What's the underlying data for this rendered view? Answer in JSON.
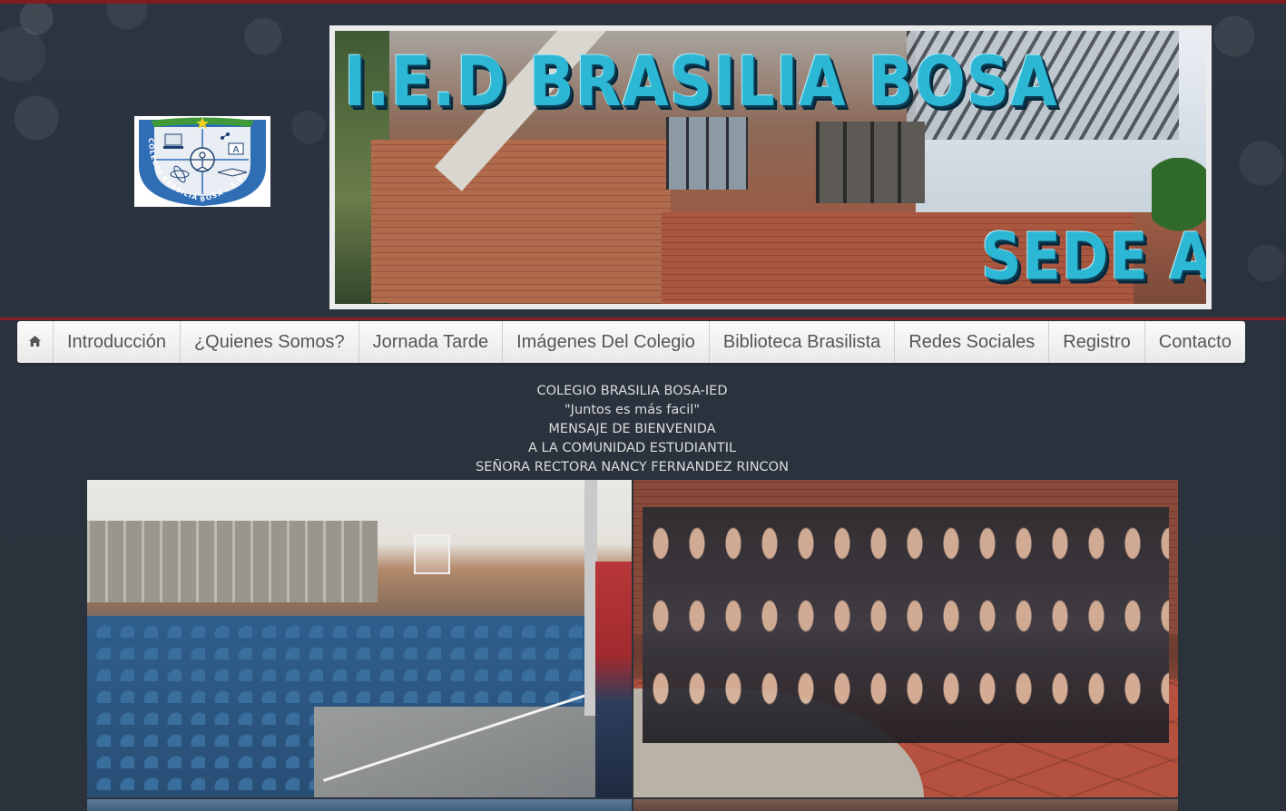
{
  "banner": {
    "title": "I.E.D BRASILIA BOSA",
    "subtitle": "SEDE A"
  },
  "logo": {
    "ring_text": "COLEGIO BRASILIA BOSA I.E.D."
  },
  "nav": {
    "home_icon": "home-icon",
    "items": [
      {
        "label": "Introducción"
      },
      {
        "label": "¿Quienes Somos?"
      },
      {
        "label": "Jornada Tarde"
      },
      {
        "label": "Imágenes Del Colegio"
      },
      {
        "label": "Biblioteca Brasilista"
      },
      {
        "label": "Redes Sociales"
      },
      {
        "label": "Registro"
      },
      {
        "label": "Contacto"
      }
    ]
  },
  "intro": {
    "line1": "COLEGIO BRASILIA BOSA-IED",
    "line2": "\"Juntos es más facil\"",
    "line3": "MENSAJE DE BIENVENIDA",
    "line4": "A LA COMUNIDAD ESTUDIANTIL",
    "line5": "SEÑORA RECTORA NANCY FERNANDEZ RINCON"
  },
  "colors": {
    "background": "#2b323c",
    "accent_red": "#8b1e22",
    "banner_text": "#2cb7d4",
    "nav_text": "#555555",
    "intro_text": "#dcdcdc"
  }
}
